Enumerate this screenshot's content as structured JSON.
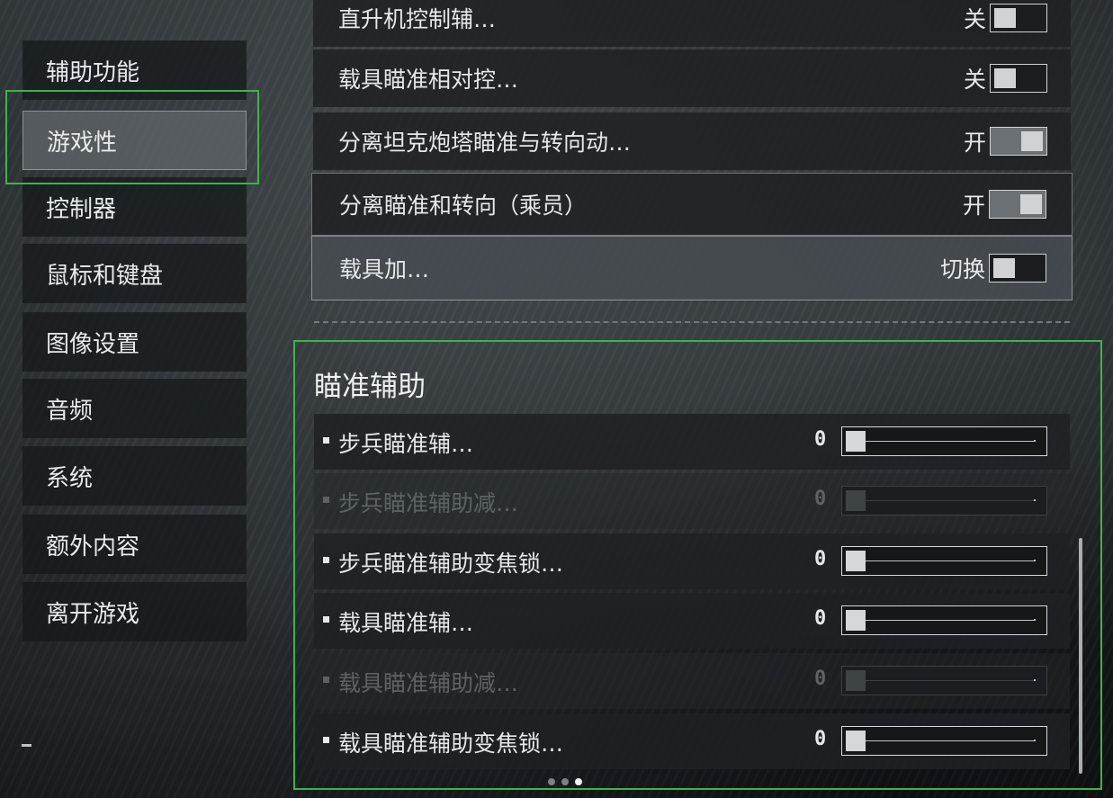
{
  "sidebar": {
    "items": [
      {
        "label": "辅助功能"
      },
      {
        "label": "游戏性"
      },
      {
        "label": "控制器"
      },
      {
        "label": "鼠标和键盘"
      },
      {
        "label": "图像设置"
      },
      {
        "label": "音频"
      },
      {
        "label": "系统"
      },
      {
        "label": "额外内容"
      },
      {
        "label": "离开游戏"
      }
    ],
    "selected": "游戏性"
  },
  "settings": [
    {
      "label": "直升机控制辅…",
      "value": "关",
      "toggle_state": "off"
    },
    {
      "label": "载具瞄准相对控…",
      "value": "关",
      "toggle_state": "off"
    },
    {
      "label": "分离坦克炮塔瞄准与转向动…",
      "value": "开",
      "toggle_state": "on"
    },
    {
      "label": "分离瞄准和转向（乘员）",
      "value": "开",
      "toggle_state": "on"
    },
    {
      "label": "载具加…",
      "value": "切换",
      "toggle_state": "off"
    }
  ],
  "aim_assist": {
    "title": "瞄准辅助",
    "items": [
      {
        "label": "步兵瞄准辅…",
        "value": "0",
        "enabled": true
      },
      {
        "label": "步兵瞄准辅助减…",
        "value": "0",
        "enabled": false
      },
      {
        "label": "步兵瞄准辅助变焦锁…",
        "value": "0",
        "enabled": true
      },
      {
        "label": "载具瞄准辅…",
        "value": "0",
        "enabled": true
      },
      {
        "label": "载具瞄准辅助减…",
        "value": "0",
        "enabled": false
      },
      {
        "label": "载具瞄准辅助变焦锁…",
        "value": "0",
        "enabled": true
      }
    ]
  },
  "pagination": {
    "total": 3,
    "current": 3
  },
  "colors": {
    "focus": "#3bb54a",
    "text": "#e6e8ea",
    "disabled_text": "#5c6266"
  }
}
